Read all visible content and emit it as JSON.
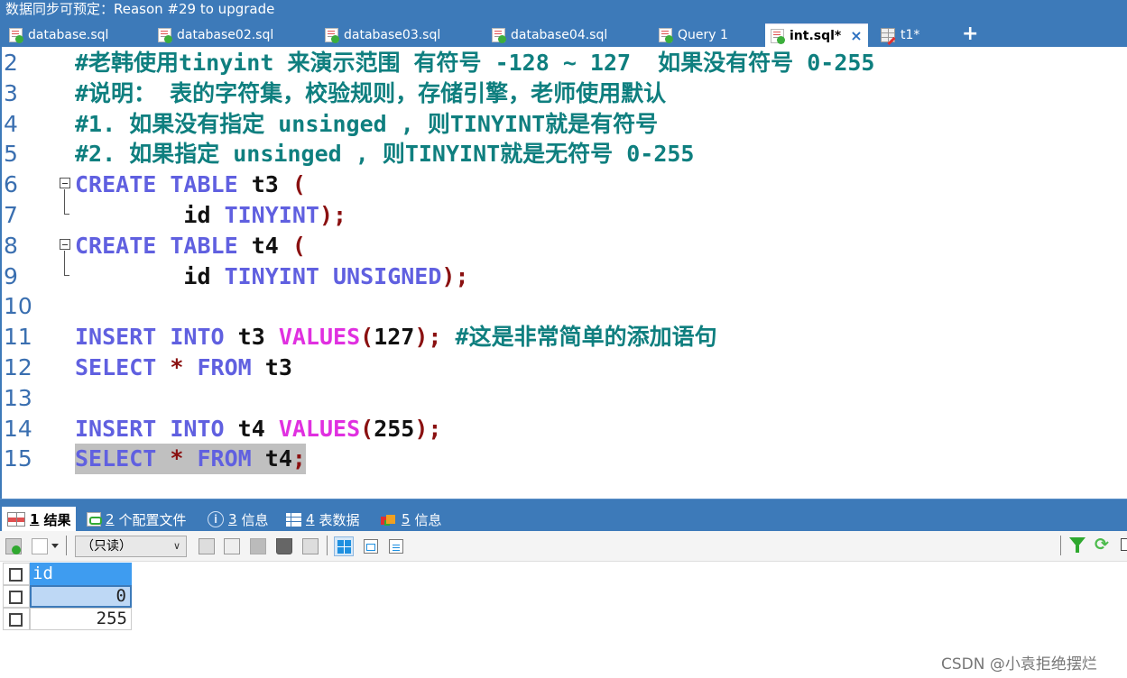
{
  "titlebar": {
    "text": "数据同步可预定：Reason #29 to upgrade"
  },
  "tabs": [
    {
      "label": "database.sql",
      "icon": "sql-file-icon",
      "active": false
    },
    {
      "label": "database02.sql",
      "icon": "sql-file-icon",
      "active": false
    },
    {
      "label": "database03.sql",
      "icon": "sql-file-icon",
      "active": false
    },
    {
      "label": "database04.sql",
      "icon": "sql-file-icon",
      "active": false
    },
    {
      "label": "Query 1",
      "icon": "sql-file-icon",
      "active": false
    },
    {
      "label": "int.sql*",
      "icon": "sql-file-icon",
      "active": true,
      "close": "×"
    },
    {
      "label": "t1*",
      "icon": "table-edit-icon",
      "active": false
    }
  ],
  "tab_add": "+",
  "editor": {
    "lines": [
      {
        "n": "2",
        "segs": [
          [
            "cmt",
            "#老韩使用tinyint 来演示范围 有符号 -128 ~ 127  如果没有符号 0-255"
          ]
        ]
      },
      {
        "n": "3",
        "segs": [
          [
            "cmt",
            "#说明： 表的字符集，校验规则，存储引擎，老师使用默认"
          ]
        ]
      },
      {
        "n": "4",
        "segs": [
          [
            "cmt",
            "#1. 如果没有指定 unsinged , 则TINYINT就是有符号"
          ]
        ]
      },
      {
        "n": "5",
        "segs": [
          [
            "cmt",
            "#2. 如果指定 unsinged , 则TINYINT就是无符号 0-255"
          ]
        ]
      },
      {
        "n": "6",
        "fold": "start",
        "segs": [
          [
            "kw",
            "CREATE"
          ],
          [
            "id",
            " "
          ],
          [
            "kw",
            "TABLE"
          ],
          [
            "id",
            " t3 "
          ],
          [
            "pn",
            "("
          ]
        ]
      },
      {
        "n": "7",
        "fold": "end",
        "segs": [
          [
            "id",
            "        id "
          ],
          [
            "kw",
            "TINYINT"
          ],
          [
            "pn",
            ");"
          ]
        ]
      },
      {
        "n": "8",
        "fold": "start",
        "segs": [
          [
            "kw",
            "CREATE"
          ],
          [
            "id",
            " "
          ],
          [
            "kw",
            "TABLE"
          ],
          [
            "id",
            " t4 "
          ],
          [
            "pn",
            "("
          ]
        ]
      },
      {
        "n": "9",
        "fold": "end",
        "segs": [
          [
            "id",
            "        id "
          ],
          [
            "kw",
            "TINYINT"
          ],
          [
            "id",
            " "
          ],
          [
            "kw",
            "UNSIGNED"
          ],
          [
            "pn",
            ");"
          ]
        ]
      },
      {
        "n": "10",
        "segs": []
      },
      {
        "n": "11",
        "segs": [
          [
            "kw",
            "INSERT"
          ],
          [
            "id",
            " "
          ],
          [
            "kw",
            "INTO"
          ],
          [
            "id",
            " t3 "
          ],
          [
            "fn",
            "VALUES"
          ],
          [
            "pn",
            "("
          ],
          [
            "id",
            "127"
          ],
          [
            "pn",
            ");"
          ],
          [
            "id",
            " "
          ],
          [
            "cmt",
            "#这是非常简单的添加语句"
          ]
        ]
      },
      {
        "n": "12",
        "segs": [
          [
            "kw",
            "SELECT"
          ],
          [
            "id",
            " "
          ],
          [
            "pn",
            "*"
          ],
          [
            "id",
            " "
          ],
          [
            "kw",
            "FROM"
          ],
          [
            "id",
            " t3"
          ]
        ]
      },
      {
        "n": "13",
        "segs": []
      },
      {
        "n": "14",
        "segs": [
          [
            "kw",
            "INSERT"
          ],
          [
            "id",
            " "
          ],
          [
            "kw",
            "INTO"
          ],
          [
            "id",
            " t4 "
          ],
          [
            "fn",
            "VALUES"
          ],
          [
            "pn",
            "("
          ],
          [
            "id",
            "255"
          ],
          [
            "pn",
            ");"
          ]
        ]
      },
      {
        "n": "15",
        "selected": true,
        "segs": [
          [
            "kw",
            "SELECT"
          ],
          [
            "id",
            " "
          ],
          [
            "pn",
            "*"
          ],
          [
            "id",
            " "
          ],
          [
            "kw",
            "FROM"
          ],
          [
            "id",
            " t4"
          ],
          [
            "pn",
            ";"
          ]
        ]
      }
    ]
  },
  "result_tabs": [
    {
      "num": "1",
      "label": "结果",
      "icon": "result-grid-icon",
      "active": true
    },
    {
      "num": "2",
      "label": "个配置文件",
      "icon": "profile-icon",
      "active": false
    },
    {
      "num": "3",
      "label": "信息",
      "icon": "info-icon",
      "active": false
    },
    {
      "num": "4",
      "label": "表数据",
      "icon": "table-data-icon",
      "active": false
    },
    {
      "num": "5",
      "label": "信息",
      "icon": "info-blocks-icon",
      "active": false
    }
  ],
  "toolbar": {
    "mode_select": "（只读）",
    "info_glyph": "i",
    "refresh_glyph": "⟳"
  },
  "result_grid": {
    "columns": [
      "id"
    ],
    "rows": [
      [
        "0"
      ],
      [
        "255"
      ]
    ],
    "selected_row": 0
  },
  "watermark": "CSDN @小袁拒绝摆烂"
}
